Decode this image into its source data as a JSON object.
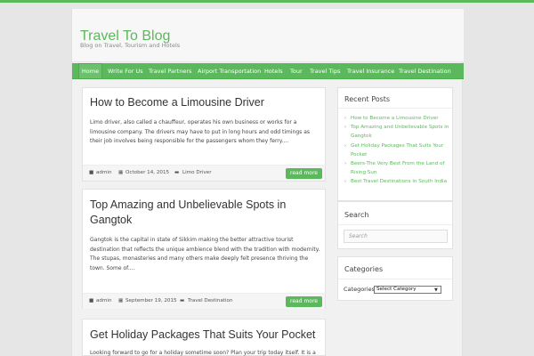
{
  "site": {
    "title": "Travel To Blog",
    "description": "Blog on Travel, Tourism and Hotels",
    "accent": "#5cb85c"
  },
  "nav": {
    "items": [
      {
        "label": "Home",
        "active": true
      },
      {
        "label": "Write For Us"
      },
      {
        "label": "Travel Partners"
      },
      {
        "label": "Airport Transportation"
      },
      {
        "label": "Hotels"
      },
      {
        "label": "Tour"
      },
      {
        "label": "Travel Tips"
      },
      {
        "label": "Travel Insurance"
      },
      {
        "label": "Travel Destination"
      }
    ]
  },
  "posts": [
    {
      "title": "How to Become a Limousine Driver",
      "excerpt": "Limo driver, also called a chauffeur, operates his own business or works for a limousine company. The drivers may have to put in long hours and odd timings as their job involves being responsible for the passengers whom they ferry....",
      "author": "admin",
      "date": "October 14, 2015",
      "category": "Limo Driver",
      "read_more": "read more"
    },
    {
      "title": "Top Amazing and Unbelievable Spots in Gangtok",
      "excerpt": "Gangtok is the capital in state of Sikkim making the better attractive tourist destination that reflects the unique ambience blend with the tradition with modernity. The stupas, monasteries and many others make deeply felt presence thriving the town. Some of....",
      "author": "admin",
      "date": "September 19, 2015",
      "category": "Travel Destination",
      "read_more": "read more"
    },
    {
      "title": "Get Holiday Packages That Suits Your Pocket",
      "excerpt": "Looking forward to go for a holiday sometime soon? Plan your trip today itself. It is a"
    }
  ],
  "sidebar": {
    "recent": {
      "title": "Recent Posts",
      "items": [
        "How to Become a Limousine Driver",
        "Top Amazing and Unbelievable Spots in Gangtok",
        "Get Holiday Packages That Suits Your Pocket",
        "Beers-The Very Best From the Land of Rising Sun",
        "Best Travel Destinations in South India"
      ]
    },
    "search": {
      "title": "Search",
      "placeholder": "Search"
    },
    "categories": {
      "title": "Categories",
      "label": "Categories",
      "selected": "Select Category"
    }
  },
  "icons": {
    "author": "user-icon",
    "date": "calendar-icon",
    "category": "folder-icon",
    "bullet": "arrow-right-icon"
  }
}
